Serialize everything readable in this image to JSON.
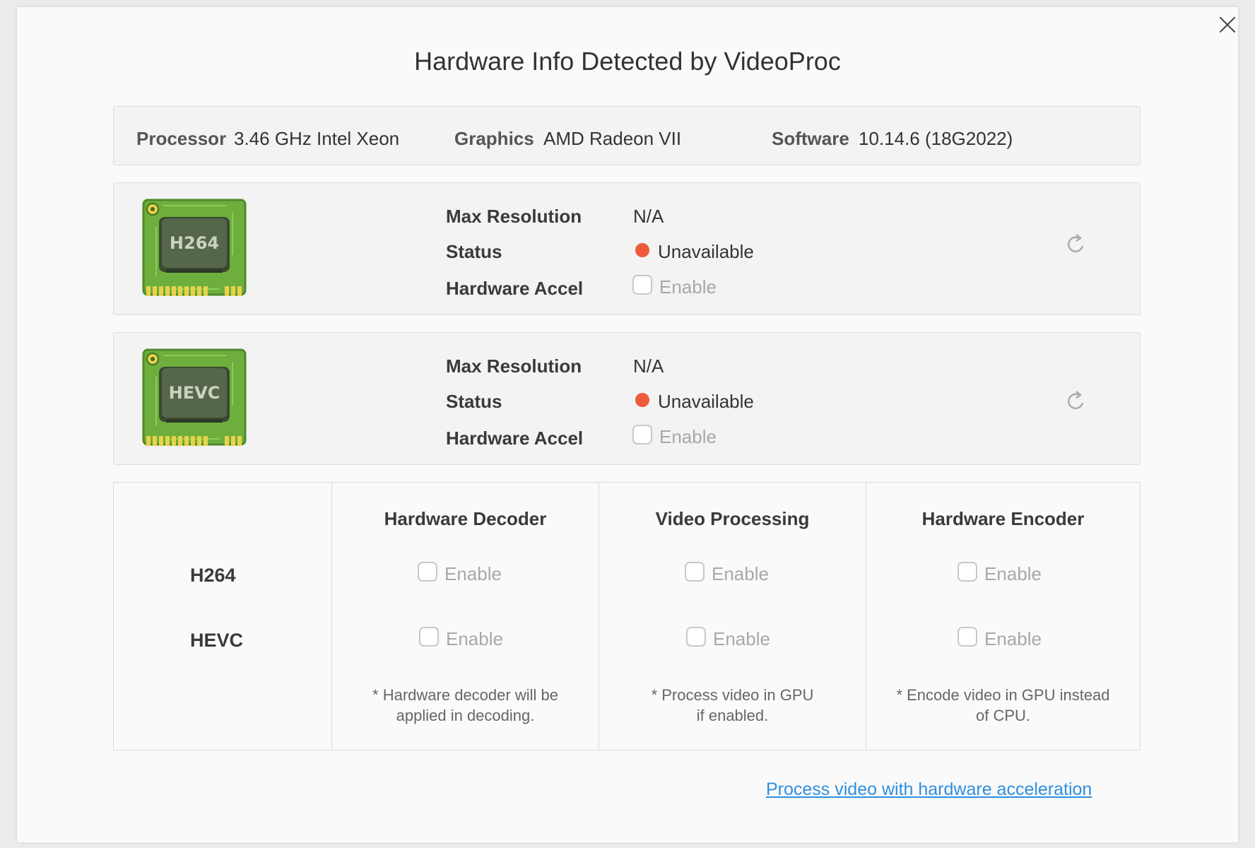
{
  "dialog": {
    "title": "Hardware Info Detected by VideoProc",
    "close_icon": "close-icon"
  },
  "info": {
    "processor_label": "Processor",
    "processor_value": "3.46 GHz Intel Xeon",
    "graphics_label": "Graphics",
    "graphics_value": "AMD Radeon VII",
    "software_label": "Software",
    "software_value": "10.14.6 (18G2022)"
  },
  "codecs": [
    {
      "chip_text": "H264",
      "max_res_label": "Max Resolution",
      "max_res_value": "N/A",
      "status_label": "Status",
      "status_value": "Unavailable",
      "status_color": "#ee5a3b",
      "accel_label": "Hardware Accel",
      "accel_option": "Enable",
      "accel_checked": false,
      "refresh_icon": "refresh-icon"
    },
    {
      "chip_text": "HEVC",
      "max_res_label": "Max Resolution",
      "max_res_value": "N/A",
      "status_label": "Status",
      "status_value": "Unavailable",
      "status_color": "#ee5a3b",
      "accel_label": "Hardware Accel",
      "accel_option": "Enable",
      "accel_checked": false,
      "refresh_icon": "refresh-icon"
    }
  ],
  "matrix": {
    "columns": [
      "Hardware Decoder",
      "Video Processing",
      "Hardware Encoder"
    ],
    "rows": [
      "H264",
      "HEVC"
    ],
    "option_label": "Enable",
    "cells": [
      [
        false,
        false,
        false
      ],
      [
        false,
        false,
        false
      ]
    ],
    "notes": [
      [
        "* Hardware decoder will be",
        "applied in decoding."
      ],
      [
        "* Process video in GPU",
        "if enabled."
      ],
      [
        "* Encode video in GPU instead",
        "of CPU."
      ]
    ]
  },
  "footer": {
    "link_text": "Process video with hardware acceleration",
    "link_color": "#2f8fe0"
  },
  "colors": {
    "background": "#fafafa",
    "panel": "#f3f3f3",
    "chip_green": "#6dae3c",
    "status_red": "#ee5a3b"
  }
}
